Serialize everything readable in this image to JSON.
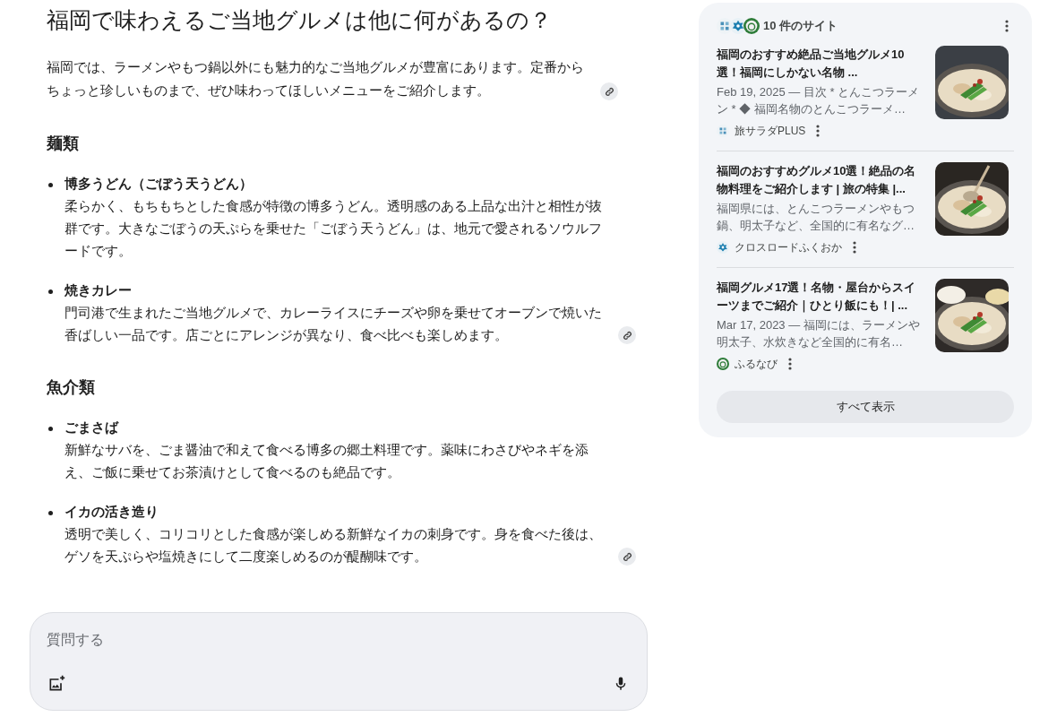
{
  "answer": {
    "title": "福岡で味わえるご当地グルメは他に何があるの？",
    "intro": {
      "text": "福岡では、ラーメンやもつ鍋以外にも魅力的なご当地グルメが豊富にあります。定番からちょっと珍しいものまで、ぜひ味わってほしいメニューをご紹介します。",
      "link": true
    },
    "sections": [
      {
        "heading": "麺類",
        "items": [
          {
            "title": "博多うどん（ごぼう天うどん）",
            "text": "柔らかく、もちもちとした食感が特徴の博多うどん。透明感のある上品な出汁と相性が抜群です。大きなごぼうの天ぷらを乗せた「ごぼう天うどん」は、地元で愛されるソウルフードです。",
            "link": false
          },
          {
            "title": "焼きカレー",
            "text": "門司港で生まれたご当地グルメで、カレーライスにチーズや卵を乗せてオーブンで焼いた香ばしい一品です。店ごとにアレンジが異なり、食べ比べも楽しめます。",
            "link": true
          }
        ]
      },
      {
        "heading": "魚介類",
        "items": [
          {
            "title": "ごまさば",
            "text": "新鮮なサバを、ごま醤油で和えて食べる博多の郷土料理です。薬味にわさびやネギを添え、ご飯に乗せてお茶漬けとして食べるのも絶品です。",
            "link": false
          },
          {
            "title": "イカの活き造り",
            "text": "透明で美しく、コリコリとした食感が楽しめる新鮮なイカの刺身です。身を食べた後は、ゲソを天ぷらや塩焼きにして二度楽しめるのが醍醐味です。",
            "link": true
          }
        ]
      }
    ]
  },
  "sources": {
    "count": "10 件のサイト",
    "items": [
      {
        "title": "福岡のおすすめ絶品ご当地グルメ10選！福岡にしかない名物 ...",
        "snippet": "Feb 19, 2025 — 目次 * とんこつラーメン * ◆ 福岡名物のとんこつラーメ…",
        "site": "旅サラダPLUS"
      },
      {
        "title": "福岡のおすすめグルメ10選！絶品の名物料理をご紹介します | 旅の特集 |...",
        "snippet": "福岡県には、とんこつラーメンやもつ鍋、明太子など、全国的に有名なグ…",
        "site": "クロスロードふくおか"
      },
      {
        "title": "福岡グルメ17選！名物・屋台からスイーツまでご紹介｜ひとり飯にも！| ...",
        "snippet": "Mar 17, 2023 — 福岡には、ラーメンや明太子、水炊きなど全国的に有名…",
        "site": "ふるなび"
      }
    ],
    "show_all": "すべて表示"
  },
  "composer": {
    "placeholder": "質問する"
  }
}
